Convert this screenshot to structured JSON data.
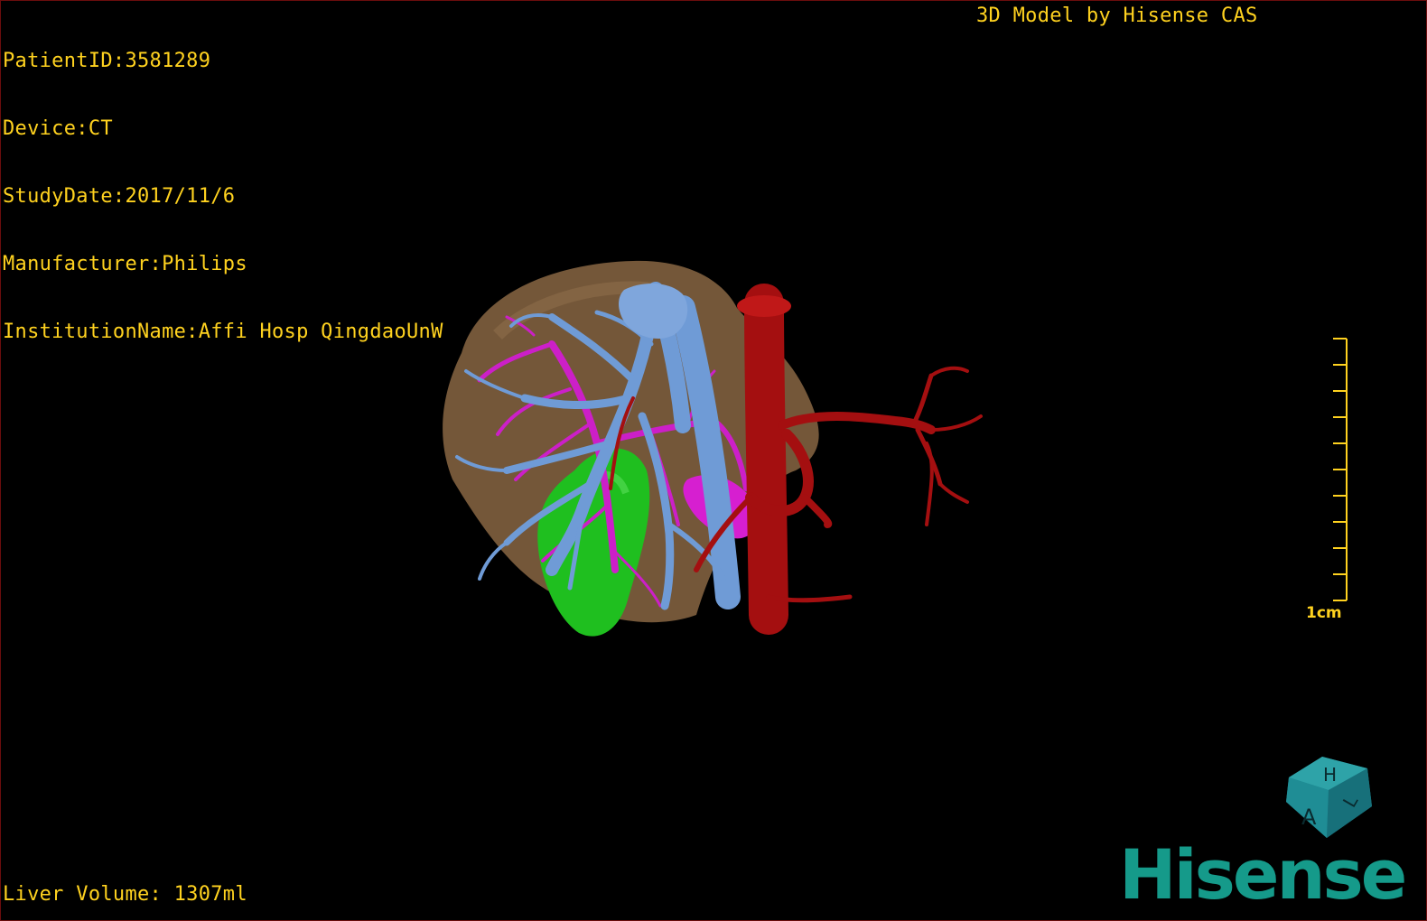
{
  "overlay": {
    "patient_id": "PatientID:3581289",
    "device": "Device:CT",
    "study_date": "StudyDate:2017/11/6",
    "manufacturer": "Manufacturer:Philips",
    "institution": "InstitutionName:Affi Hosp QingdaoUnW",
    "title": "3D Model by Hisense CAS",
    "liver_volume": "Liver Volume: 1307ml"
  },
  "scale": {
    "label": "1cm"
  },
  "orientation_cube": {
    "face_top": "H",
    "face_front": "A",
    "face_side": "L"
  },
  "brand": {
    "name": "Hisense",
    "color": "#159a8a"
  },
  "colors": {
    "text": "#ffd21f",
    "liver": "#8a6a45",
    "portal_vein": "#6f9bd6",
    "hepatic_vein": "#d21fc8",
    "artery": "#a40f10",
    "gallbladder": "#1fbf1f"
  }
}
